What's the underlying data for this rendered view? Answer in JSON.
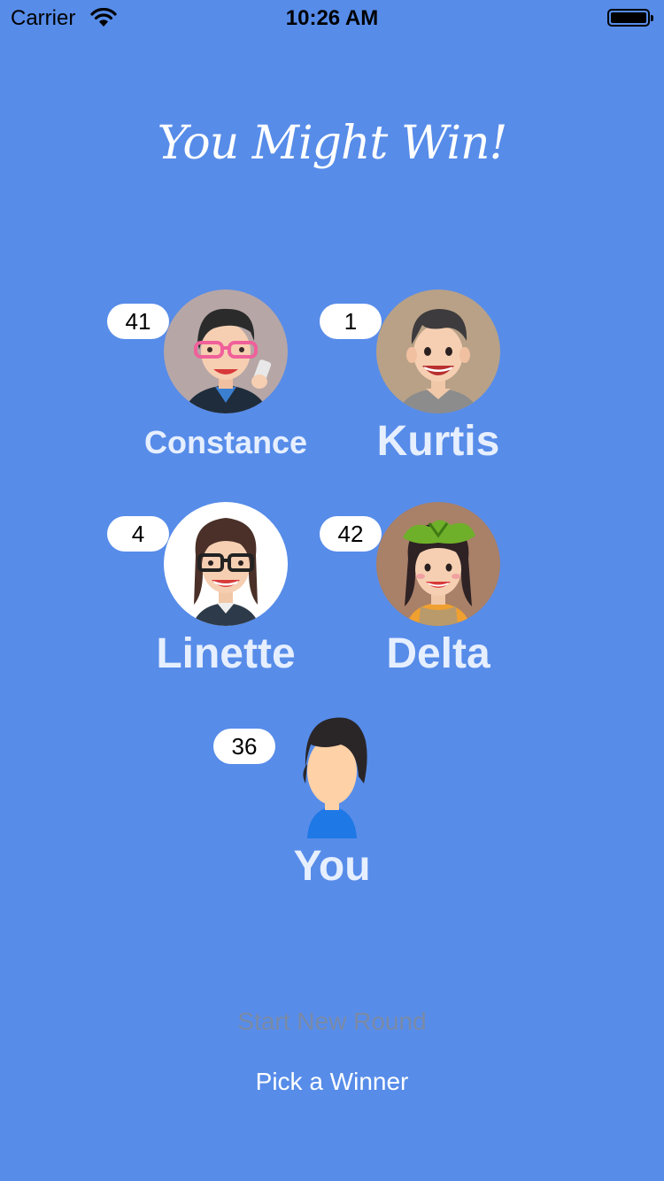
{
  "status": {
    "carrier": "Carrier",
    "time": "10:26 AM"
  },
  "title": "You Might Win!",
  "players": [
    {
      "name": "Constance",
      "score": "41"
    },
    {
      "name": "Kurtis",
      "score": "1"
    },
    {
      "name": "Linette",
      "score": "4"
    },
    {
      "name": "Delta",
      "score": "42"
    },
    {
      "name": "You",
      "score": "36"
    }
  ],
  "actions": {
    "start_label": "Start New Round",
    "pick_label": "Pick a Winner"
  },
  "colors": {
    "background": "#578ce9",
    "badge": "#ffffff",
    "name_text": "#e6efff"
  }
}
